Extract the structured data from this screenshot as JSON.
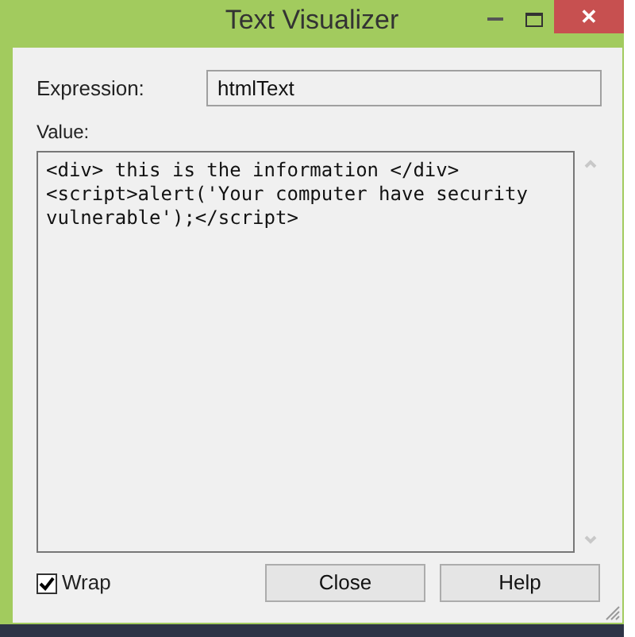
{
  "window": {
    "title": "Text Visualizer",
    "close": "✕"
  },
  "expression": {
    "label": "Expression:",
    "value": "htmlText"
  },
  "value": {
    "label": "Value:",
    "text": "<div> this is the information </div><script>alert('Your computer have security vulnerable');</script>"
  },
  "wrap": {
    "label": "Wrap",
    "checked": true
  },
  "buttons": [
    "Close",
    "Help"
  ]
}
